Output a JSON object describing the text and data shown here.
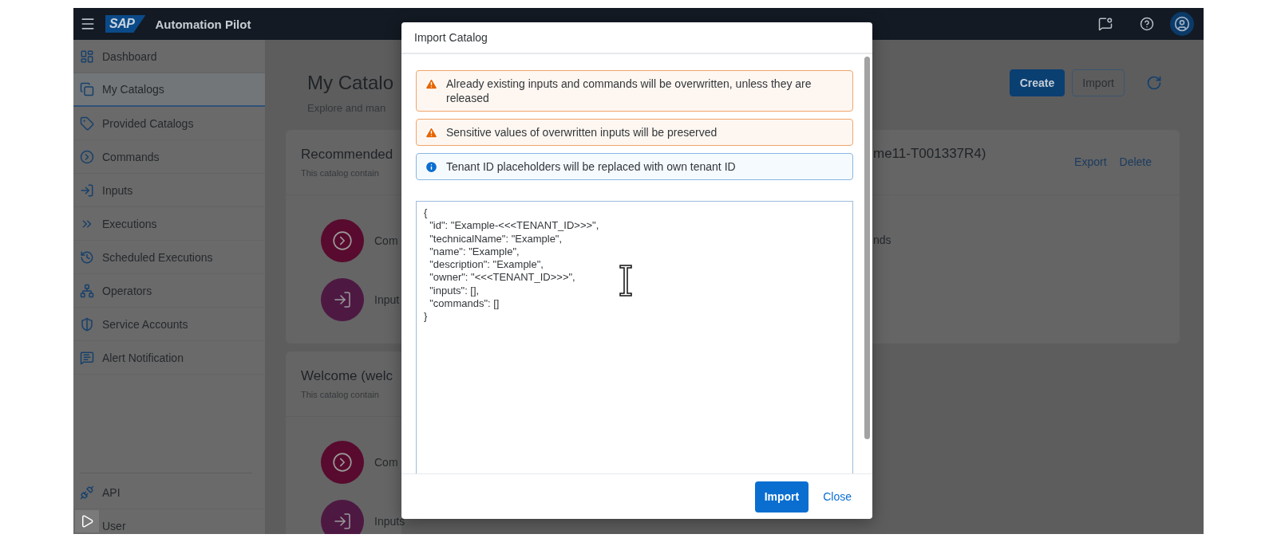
{
  "shell": {
    "logo": "SAP",
    "title": "Automation Pilot"
  },
  "sidebar": {
    "items": [
      {
        "label": "Dashboard",
        "selected": false
      },
      {
        "label": "My Catalogs",
        "selected": true
      },
      {
        "label": "Provided Catalogs",
        "selected": false
      },
      {
        "label": "Commands",
        "selected": false
      },
      {
        "label": "Inputs",
        "selected": false
      },
      {
        "label": "Executions",
        "selected": false
      },
      {
        "label": "Scheduled Executions",
        "selected": false
      },
      {
        "label": "Operators",
        "selected": false
      },
      {
        "label": "Service Accounts",
        "selected": false
      },
      {
        "label": "Alert Notification",
        "selected": false
      }
    ],
    "footer_items": [
      {
        "label": "API"
      },
      {
        "label": "User"
      }
    ]
  },
  "page": {
    "title": "My Catalo",
    "subtitle": "Explore and man",
    "actions": [
      {
        "label": "Create",
        "kind": "primary"
      },
      {
        "label": "Import",
        "kind": "secondary"
      }
    ]
  },
  "cards": [
    {
      "title": "Recommended",
      "subtitle": "This catalog contain",
      "title_right": "me11-T001337R4)",
      "links": [
        "Export",
        "Delete"
      ],
      "entries": [
        {
          "kind": "commands",
          "label": "Com"
        },
        {
          "kind": "inputs",
          "label": "Input"
        }
      ],
      "entry_right": "nds"
    },
    {
      "title": "Welcome (welc",
      "subtitle": "This catalog contain",
      "entries": [
        {
          "kind": "commands",
          "label": "Com"
        },
        {
          "kind": "inputs",
          "label": "Inputs"
        }
      ]
    }
  ],
  "dialog": {
    "title": "Import Catalog",
    "messages": [
      {
        "kind": "warning",
        "text": "Already existing inputs and commands will be overwritten, unless they are released"
      },
      {
        "kind": "warning",
        "text": "Sensitive values of overwritten inputs will be preserved"
      },
      {
        "kind": "info",
        "text": "Tenant ID placeholders will be replaced with own tenant ID"
      }
    ],
    "editor": {
      "value": "{\n  \"id\": \"Example-<<<TENANT_ID>>>\",\n  \"technicalName\": \"Example\",\n  \"name\": \"Example\",\n  \"description\": \"Example\",\n  \"owner\": \"<<<TENANT_ID>>>\",\n  \"inputs\": [],\n  \"commands\": []\n}"
    },
    "buttons": [
      {
        "label": "Import",
        "kind": "primary"
      },
      {
        "label": "Close",
        "kind": "transparent"
      }
    ]
  }
}
